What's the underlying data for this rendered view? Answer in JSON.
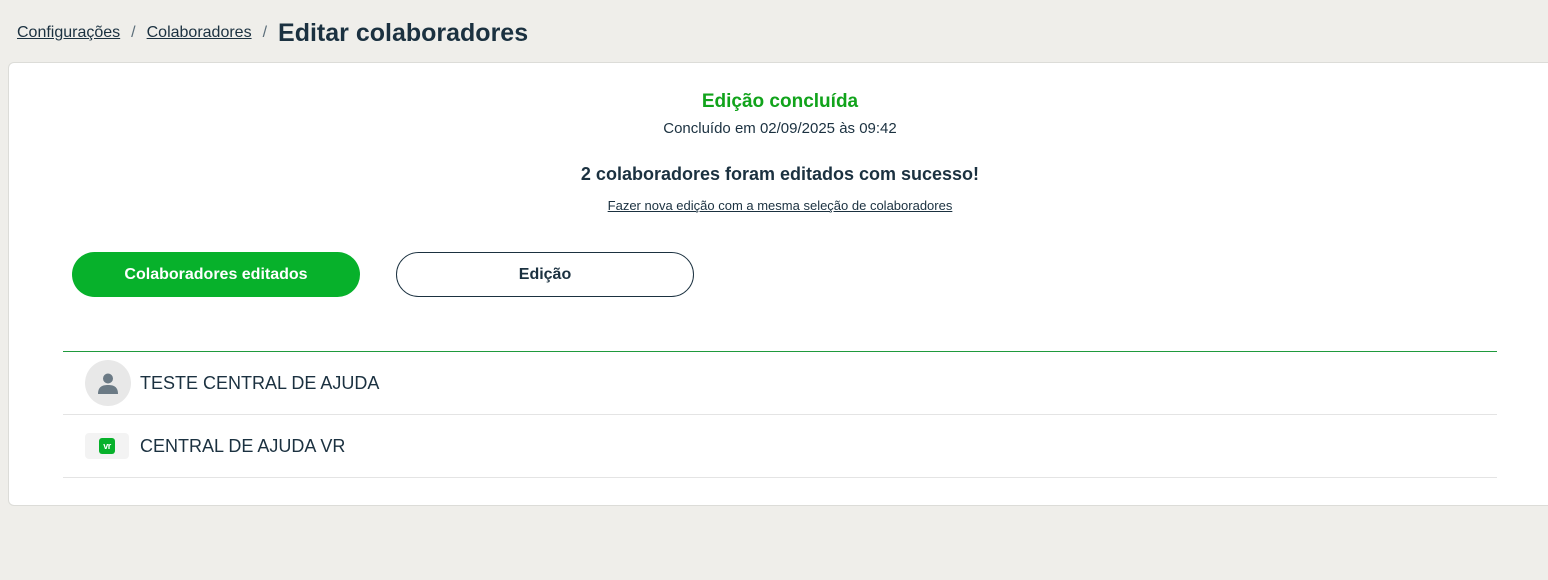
{
  "breadcrumb": {
    "items": [
      "Configurações",
      "Colaboradores"
    ],
    "separator": "/",
    "current": "Editar colaboradores"
  },
  "status": {
    "title": "Edição concluída",
    "completed_at": "Concluído em 02/09/2025 às 09:42",
    "message": "2 colaboradores foram editados com sucesso!",
    "redo_link": "Fazer nova edição com a mesma seleção de colaboradores"
  },
  "tabs": [
    {
      "label": "Colaboradores editados",
      "active": true
    },
    {
      "label": "Edição",
      "active": false
    }
  ],
  "employees": [
    {
      "name": "TESTE CENTRAL DE AJUDA",
      "avatar": "person-icon"
    },
    {
      "name": "CENTRAL DE AJUDA VR",
      "avatar": "vr-logo-icon",
      "logo_text": "vr"
    }
  ],
  "colors": {
    "accent": "#07b12b",
    "success_text": "#11a31b",
    "text": "#1b3140",
    "background": "#efeeea"
  }
}
